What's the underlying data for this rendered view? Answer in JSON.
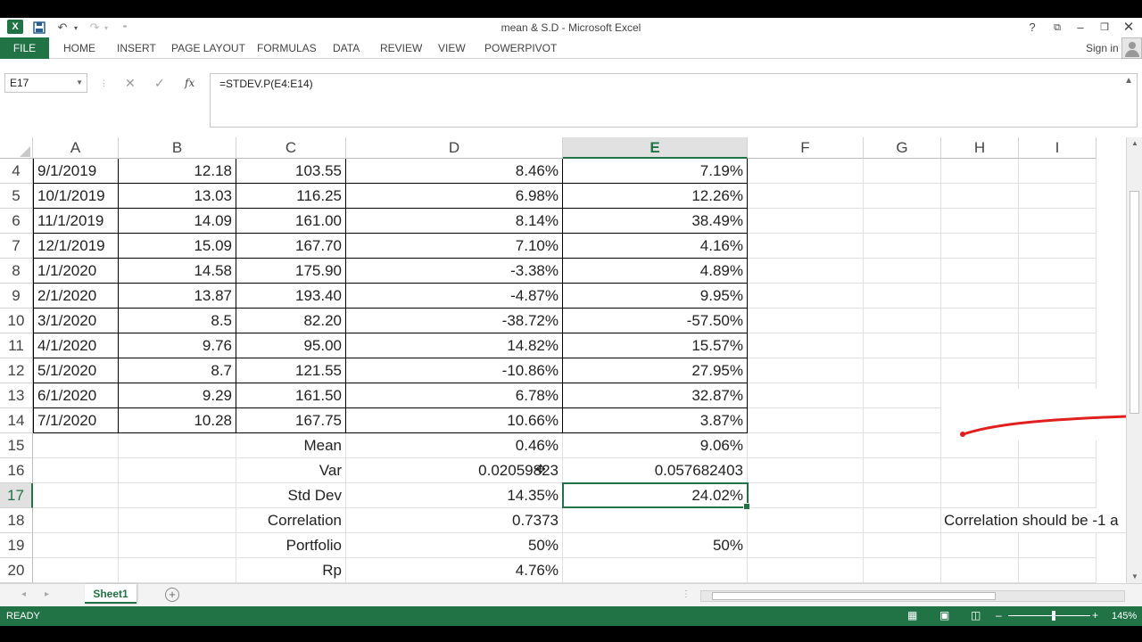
{
  "window": {
    "title": "mean & S.D - Microsoft Excel",
    "help": "?",
    "signin": "Sign in"
  },
  "ribbon": {
    "tabs": [
      "FILE",
      "HOME",
      "INSERT",
      "PAGE LAYOUT",
      "FORMULAS",
      "DATA",
      "REVIEW",
      "VIEW",
      "POWERPIVOT"
    ]
  },
  "formula_bar": {
    "name_box": "E17",
    "formula": "=STDEV.P(E4:E14)"
  },
  "columns": [
    "A",
    "B",
    "C",
    "D",
    "E",
    "F",
    "G",
    "H",
    "I"
  ],
  "selected_column": "E",
  "selected_row": "17",
  "rows": [
    {
      "n": "4",
      "A": "9/1/2019",
      "B": "12.18",
      "C": "103.55",
      "D": "8.46%",
      "E": "7.19%"
    },
    {
      "n": "5",
      "A": "10/1/2019",
      "B": "13.03",
      "C": "116.25",
      "D": "6.98%",
      "E": "12.26%"
    },
    {
      "n": "6",
      "A": "11/1/2019",
      "B": "14.09",
      "C": "161.00",
      "D": "8.14%",
      "E": "38.49%"
    },
    {
      "n": "7",
      "A": "12/1/2019",
      "B": "15.09",
      "C": "167.70",
      "D": "7.10%",
      "E": "4.16%"
    },
    {
      "n": "8",
      "A": "1/1/2020",
      "B": "14.58",
      "C": "175.90",
      "D": "-3.38%",
      "E": "4.89%"
    },
    {
      "n": "9",
      "A": "2/1/2020",
      "B": "13.87",
      "C": "193.40",
      "D": "-4.87%",
      "E": "9.95%"
    },
    {
      "n": "10",
      "A": "3/1/2020",
      "B": "8.5",
      "C": "82.20",
      "D": "-38.72%",
      "E": "-57.50%"
    },
    {
      "n": "11",
      "A": "4/1/2020",
      "B": "9.76",
      "C": "95.00",
      "D": "14.82%",
      "E": "15.57%"
    },
    {
      "n": "12",
      "A": "5/1/2020",
      "B": "8.7",
      "C": "121.55",
      "D": "-10.86%",
      "E": "27.95%"
    },
    {
      "n": "13",
      "A": "6/1/2020",
      "B": "9.29",
      "C": "161.50",
      "D": "6.78%",
      "E": "32.87%"
    },
    {
      "n": "14",
      "A": "7/1/2020",
      "B": "10.28",
      "C": "167.75",
      "D": "10.66%",
      "E": "3.87%"
    },
    {
      "n": "15",
      "A": "",
      "B": "",
      "C": "Mean",
      "D": "0.46%",
      "E": "9.06%"
    },
    {
      "n": "16",
      "A": "",
      "B": "",
      "C": "Var",
      "D": "0.02059823",
      "E": "0.057682403"
    },
    {
      "n": "17",
      "A": "",
      "B": "",
      "C": "Std Dev",
      "D": "14.35%",
      "E": "24.02%"
    },
    {
      "n": "18",
      "A": "",
      "B": "",
      "C": "Correlation",
      "D": "0.7373",
      "E": "",
      "H": "Correlation should be -1 a"
    },
    {
      "n": "19",
      "A": "",
      "B": "",
      "C": "Portfolio",
      "D": "50%",
      "E": "50%"
    },
    {
      "n": "20",
      "A": "",
      "B": "",
      "C": "Rp",
      "D": "4.76%",
      "E": ""
    }
  ],
  "sheet_tabs": [
    "Sheet1"
  ],
  "status": {
    "ready": "READY",
    "zoom": "145%"
  },
  "colors": {
    "accent": "#217346",
    "annotation": "#e0201f"
  }
}
